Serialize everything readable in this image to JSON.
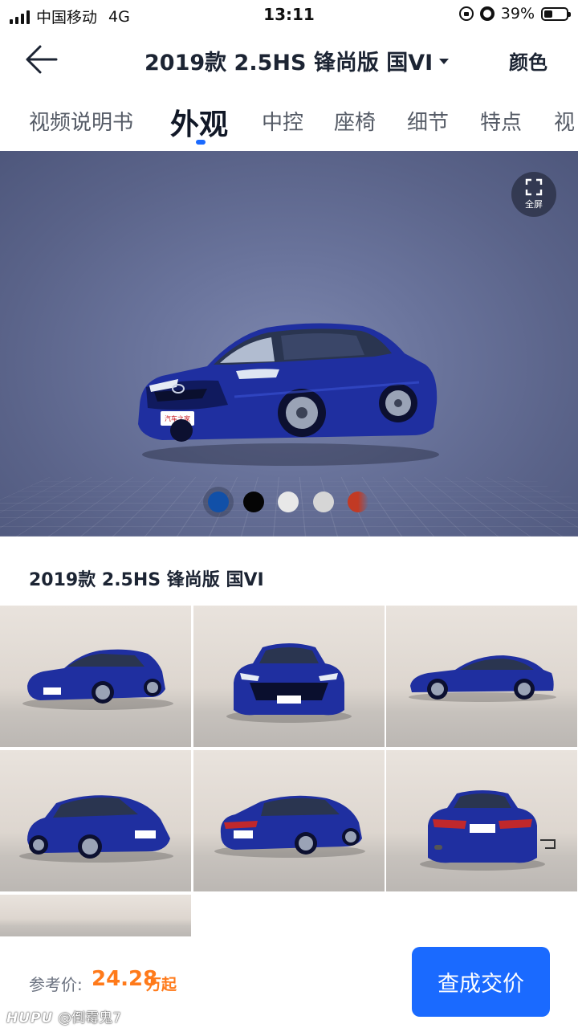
{
  "status_bar": {
    "carrier": "中国移动",
    "network": "4G",
    "time": "13:11",
    "battery": "39%",
    "battery_level": 0.39
  },
  "header": {
    "title": "2019款 2.5HS 锋尚版 国VI",
    "color_button": "颜色"
  },
  "tabs": [
    {
      "label": "视频说明书",
      "active": false
    },
    {
      "label": "外观",
      "active": true
    },
    {
      "label": "中控",
      "active": false
    },
    {
      "label": "座椅",
      "active": false
    },
    {
      "label": "细节",
      "active": false
    },
    {
      "label": "特点",
      "active": false
    },
    {
      "label": "视",
      "active": false
    }
  ],
  "hero": {
    "fullscreen_label": "全屏",
    "car_plate": "汽车之家",
    "swatch_colors": [
      "#1150a8",
      "#050505",
      "#e8e8e8",
      "#d6d6d6",
      "#c23a24"
    ],
    "selected_swatch": 0
  },
  "gallery": {
    "title": "2019款 2.5HS 锋尚版 国VI",
    "views": [
      "front-left",
      "front",
      "side",
      "front-left-low",
      "rear-left",
      "rear",
      "blank"
    ]
  },
  "bottom": {
    "price_label": "参考价:",
    "price_value": "24.28",
    "price_unit": "万起",
    "cta": "查成交价"
  },
  "watermark": {
    "logo": "HUPU",
    "user": "@倒霉鬼7"
  },
  "colors": {
    "accent": "#1a6aff",
    "price": "#ff7a1a",
    "car_body": "#1f2fa0"
  }
}
